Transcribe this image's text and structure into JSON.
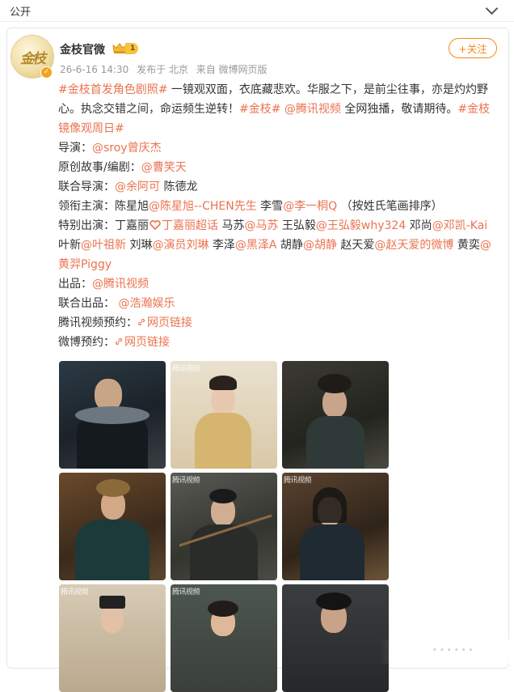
{
  "top": {
    "visibility": "公开"
  },
  "post": {
    "account_name": "金枝官微",
    "level_badge": "1",
    "avatar_text": "金枝",
    "timestamp": "26-6-16 14:30",
    "published_from": "发布于 北京",
    "source": "来自 微博网页版",
    "follow_label": "+关注",
    "hashtag_first": "#金枝首发角色剧照#",
    "text_1": " 一镜观双面，衣底藏悲欢。华服之下，是前尘往事，亦是灼灼野心。执念交错之间，命运频生逆转！",
    "hashtag_jinzhi": "#金枝#",
    "mention_tencent": " @腾讯视频",
    "text_2": " 全网独播，敬请期待。",
    "hashtag_sunday": "#金枝镜像观周日#",
    "director_label": "导演：",
    "director_mention": "@sroy曾庆杰",
    "writer_label": "原创故事/编剧：",
    "writer_mention": "@曹笑天",
    "codirector_label": "联合导演：",
    "codirector_mention": "@余阿可",
    "codirector_extra": " 陈德龙",
    "lead_label": "领衔主演：陈星旭",
    "lead_mention_1": "@陈星旭--CHEN先生",
    "lead_mid": " 李雪",
    "lead_mention_2": "@李一桐Q",
    "lead_note": "（按姓氏笔画排序）",
    "special_label": "特别出演：丁嘉丽",
    "special_m1": "丁嘉丽超话",
    "special_t1": " 马苏",
    "special_m2": "@马苏",
    "special_t2": " 王弘毅",
    "special_m3": "@王弘毅why324",
    "special_t3": " 邓尚",
    "special_m4": "@邓凯-Kai",
    "special_t4": " 叶新",
    "special_m5": "@叶祖新",
    "special_t5": " 刘琳",
    "special_m6": "@演员刘琳",
    "special_t6": " 李泽",
    "special_m7": "@黑泽A",
    "special_t7": " 胡静",
    "special_m8": "@胡静",
    "special_t8": " 赵天爱",
    "special_m9": "@赵天爱的微博",
    "special_t9": " 黄奕",
    "special_m10": "@黄羿Piggy",
    "producer_label": "出品：",
    "producer_mention": "@腾讯视频",
    "coproducer_label": "联合出品：",
    "coproducer_mention": " @浩瀚娱乐",
    "tencent_reserve_label": "腾讯视频预约：",
    "weibo_reserve_label": "微博预约：",
    "link_text": "网页链接",
    "watermark": "腾讯视频"
  },
  "colors": {
    "link": "#eb7350",
    "follow": "#f08a1a",
    "meta": "#999999"
  }
}
